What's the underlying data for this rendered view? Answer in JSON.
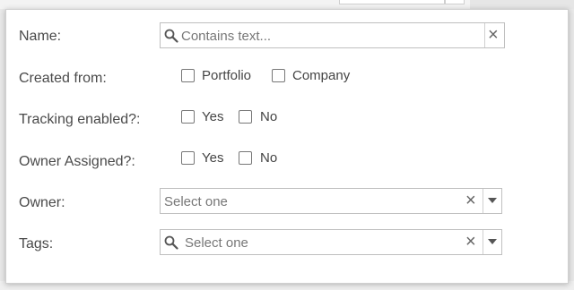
{
  "filters": {
    "name": {
      "label": "Name:",
      "placeholder": "Contains text..."
    },
    "created_from": {
      "label": "Created from:",
      "options": [
        "Portfolio",
        "Company"
      ]
    },
    "tracking_enabled": {
      "label": "Tracking enabled?:",
      "options": [
        "Yes",
        "No"
      ]
    },
    "owner_assigned": {
      "label": "Owner Assigned?:",
      "options": [
        "Yes",
        "No"
      ]
    },
    "owner": {
      "label": "Owner:",
      "placeholder": "Select one"
    },
    "tags": {
      "label": "Tags:",
      "placeholder": "Select one"
    }
  },
  "icons": {
    "clear": "×",
    "search": "search-icon",
    "dropdown": "chevron-down-icon"
  }
}
